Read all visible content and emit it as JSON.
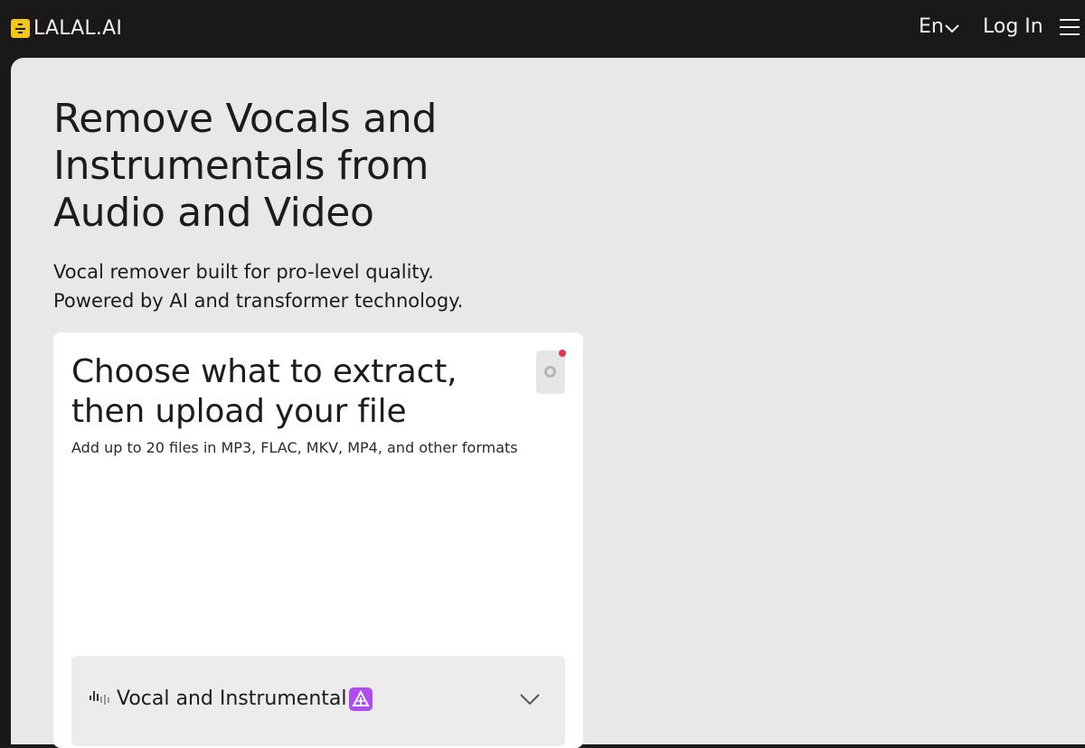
{
  "header": {
    "logo_text": "LALAL.AI",
    "language_label": "En",
    "login_label": "Log In"
  },
  "hero": {
    "title": "Remove Vocals and Instrumentals from Audio and Video",
    "subtitle_line1": "Vocal remover built for pro-level quality.",
    "subtitle_line2": "Powered by AI and transformer technology."
  },
  "upload_card": {
    "title": "Choose what to extract, then upload your file",
    "note": "Add up to 20 files in MP3, FLAC, MKV, MP4, and other formats",
    "separation_option": {
      "label": "Vocal and Instrumental",
      "icon": "waveform-icon",
      "badge_icon": "premium-badge-icon"
    },
    "settings_icon": "gear-icon"
  },
  "colors": {
    "topbar_bg": "#1a1819",
    "content_bg": "#e8e8e8",
    "logo_accent": "#f5c518",
    "notification_dot": "#e53450",
    "badge_purple": "#b04bf0"
  }
}
